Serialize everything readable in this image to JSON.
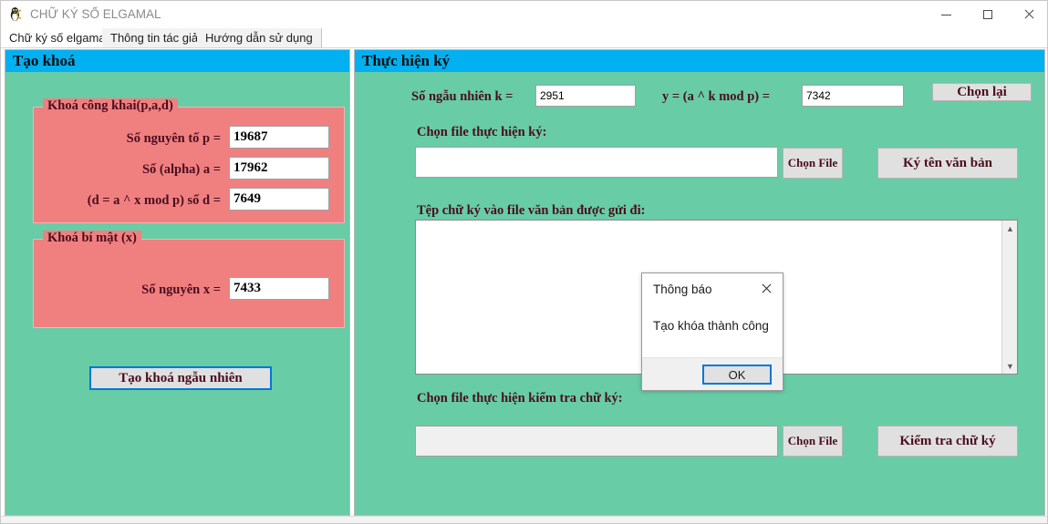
{
  "window": {
    "title": "CHỮ KÝ SỐ ELGAMAL",
    "icon": "penguin-icon",
    "minimize_label": "—",
    "maximize_label": "□",
    "close_label": "✕"
  },
  "tabs": [
    {
      "label": "Chữ ký số elgamal",
      "active": true
    },
    {
      "label": "Thông tin tác giả",
      "active": false
    },
    {
      "label": "Hướng dẫn sử dụng",
      "active": false
    }
  ],
  "colors": {
    "panel_bg": "#68cca6",
    "group_bg": "#f08080",
    "header_bg": "#00b0f0",
    "label_fg": "#4a0d1e",
    "focus_border": "#0078d7",
    "button_bg": "#e0e0e0"
  },
  "left_panel": {
    "header": "Tạo khoá",
    "public_key_group": {
      "title": "Khoá công khai(p,a,d)",
      "fields": [
        {
          "label": "Số nguyên tố p =",
          "value": "19687"
        },
        {
          "label": "Số (alpha) a =",
          "value": "17962"
        },
        {
          "label": "(d = a ^ x mod p) số d =",
          "value": "7649"
        }
      ]
    },
    "secret_key_group": {
      "title": "Khoá bí mật (x)",
      "fields": [
        {
          "label": "Số nguyên x =",
          "value": "7433"
        }
      ]
    },
    "generate_button": "Tạo khoá ngẫu nhiên"
  },
  "right_panel": {
    "header": "Thực hiện ký",
    "random_k": {
      "label": "Số ngẫu nhiên k =",
      "value": "2951"
    },
    "y_value": {
      "label": "y = (a ^ k mod p) =",
      "value": "7342"
    },
    "reset_button": "Chọn lại",
    "sign_file": {
      "label": "Chọn file thực hiện ký:",
      "path_value": "",
      "path_placeholder": "",
      "browse_button": "Chọn File",
      "action_button": "Ký tên văn bản"
    },
    "signature_output": {
      "label": "Tệp chữ ký vào file văn bản được gửi đi:",
      "value": ""
    },
    "verify_file": {
      "label": "Chọn file thực hiện kiểm tra chữ ký:",
      "path_value": "",
      "path_placeholder": "",
      "browse_button": "Chọn File",
      "action_button": "Kiểm tra chữ ký"
    }
  },
  "dialog": {
    "title": "Thông báo",
    "message": "Tạo khóa thành công",
    "ok_button": "OK",
    "close_icon": "close-icon"
  }
}
